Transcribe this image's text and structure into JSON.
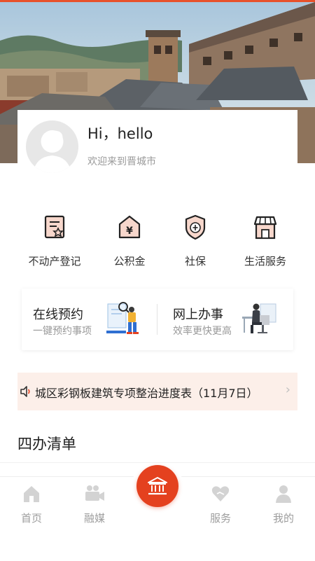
{
  "profile": {
    "greeting": "Hi，hello",
    "welcome": "欢迎来到晋城市"
  },
  "services": [
    {
      "label": "不动产登记",
      "icon": "property-certificate-icon"
    },
    {
      "label": "公积金",
      "icon": "housing-fund-icon"
    },
    {
      "label": "社保",
      "icon": "social-security-shield-icon"
    },
    {
      "label": "生活服务",
      "icon": "storefront-icon"
    }
  ],
  "quick_actions": [
    {
      "title": "在线预约",
      "subtitle": "一键预约事项"
    },
    {
      "title": "网上办事",
      "subtitle": "效率更快更高"
    }
  ],
  "notice": {
    "text": "城区彩钢板建筑专项整治进度表（11月7日）",
    "chevron": "›"
  },
  "section": {
    "title": "四办清单"
  },
  "tabbar": [
    {
      "label": "首页",
      "icon": "home-icon"
    },
    {
      "label": "融媒",
      "icon": "video-camera-icon"
    },
    {
      "label": "",
      "icon": "government-building-icon"
    },
    {
      "label": "服务",
      "icon": "heart-service-icon"
    },
    {
      "label": "我的",
      "icon": "user-icon"
    }
  ],
  "colors": {
    "accent": "#e4411f",
    "notice_bg": "#fcefe9",
    "muted_text": "#9d9d9d"
  }
}
